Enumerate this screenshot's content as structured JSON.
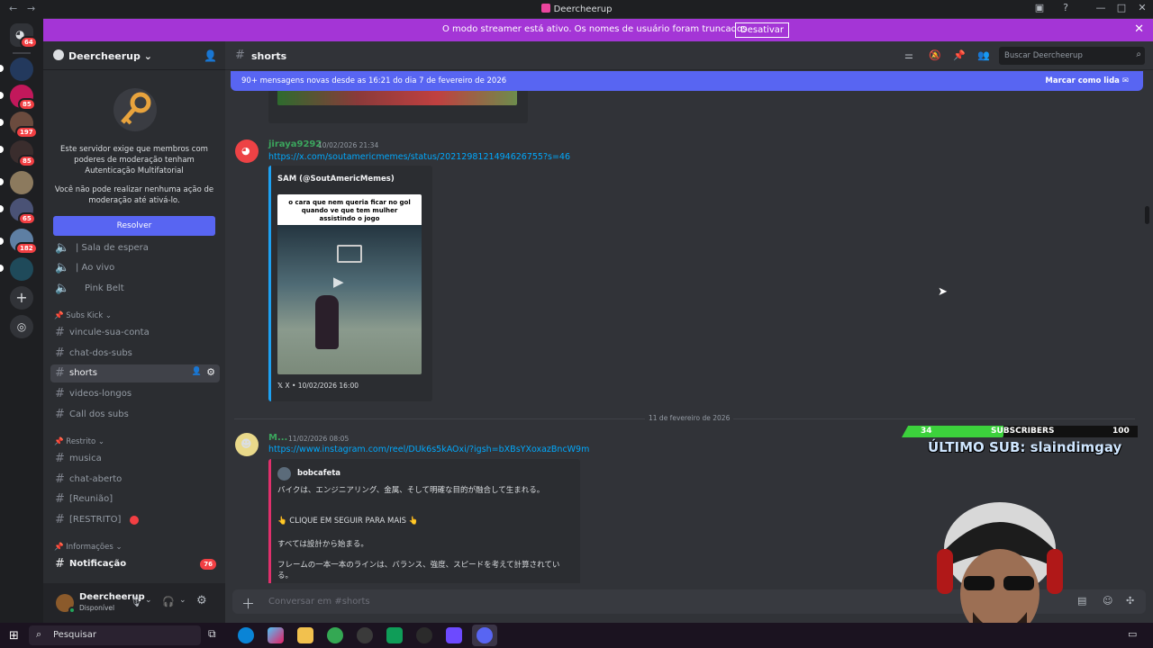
{
  "window": {
    "title": "Deercheerup"
  },
  "streamer_banner": {
    "message": "O modo streamer está ativo. Os nomes de usuário foram truncados.",
    "button": "Desativar"
  },
  "server_rail": [
    {
      "name": "home",
      "badge": "64"
    },
    {
      "name": "server-2",
      "badge": ""
    },
    {
      "name": "server-3",
      "badge": "85"
    },
    {
      "name": "server-4",
      "badge": "197"
    },
    {
      "name": "server-5",
      "badge": "85"
    },
    {
      "name": "server-6",
      "badge": ""
    },
    {
      "name": "server-7",
      "badge": "65"
    },
    {
      "name": "server-8",
      "badge": "182"
    },
    {
      "name": "server-9",
      "badge": ""
    }
  ],
  "sidebar": {
    "server_name": "Deercheerup",
    "mfa_text": "Este servidor exige que membros com poderes de moderação tenham Autenticação Multifatorial",
    "mfa_text2": "Você não pode realizar nenhuma ação de moderação até ativá-lo.",
    "resolve_button": "Resolver",
    "voice_channels": [
      "| Sala de espera",
      "| Ao vivo",
      "Pink Belt"
    ],
    "categories": {
      "subs_kick": "Subs Kick",
      "restrito": "Restrito",
      "informacoes": "Informações"
    },
    "subs_kick_channels": [
      "vincule-sua-conta",
      "chat-dos-subs",
      "shorts",
      "videos-longos",
      "Call dos subs"
    ],
    "restrito_channels": [
      "musica",
      "chat-aberto",
      "[Reunião]",
      "[RESTRITO]"
    ],
    "info_channels": [
      {
        "label": "Notificação",
        "badge": "76"
      }
    ]
  },
  "user_panel": {
    "name": "Deercheerup",
    "status": "Disponível"
  },
  "channel_header": {
    "title": "shorts",
    "search_placeholder": "Buscar Deercheerup"
  },
  "new_messages_bar": {
    "text": "90+ mensagens novas desde as 16:21 do dia 7 de fevereiro de 2026",
    "action": "Marcar como lida"
  },
  "messages": [
    {
      "author": "jiraya9292",
      "author_color": "#3ba55d",
      "timestamp": "10/02/2026 21:34",
      "link": "https://x.com/soutamericmemes/status/2021298121494626755?s=46",
      "embed": {
        "title": "SAM (@SoutAmericMemes)",
        "caption": "o cara que nem queria ficar no gol quando ve que tem mulher assistindo o jogo",
        "footer": "X • 10/02/2026 16:00"
      }
    },
    {
      "divider": "11 de fevereiro de 2026",
      "author": "M...",
      "author_color": "#3ba55d",
      "timestamp": "11/02/2026 08:05",
      "link": "https://www.instagram.com/reel/DUk6s5kAOxi/?igsh=bXBsYXoxazBncW9m",
      "embed": {
        "author": "bobcafeta",
        "line1": "バイクは、エンジニアリング、金属、そして明確な目的が融合して生まれる。",
        "line2": "👆 CLIQUE EM SEGUIR PARA MAIS 👆",
        "line3": "すべては設計から始まる。",
        "line4": "フレームの一本一本のラインは、バランス、強度、スピードを考えて計算されている。"
      }
    }
  ],
  "composer": {
    "placeholder": "Conversar em #shorts"
  },
  "overlay": {
    "current": "34",
    "label": "SUBSCRIBERS",
    "goal": "100",
    "progress": 0.34,
    "last_sub": "ÚLTIMO SUB: slaindimgay"
  },
  "taskbar": {
    "search_placeholder": "Pesquisar"
  },
  "colors": {
    "blurple": "#5865f2",
    "streamer": "#a435d6",
    "link": "#00a8fc",
    "badge": "#f23f43"
  }
}
